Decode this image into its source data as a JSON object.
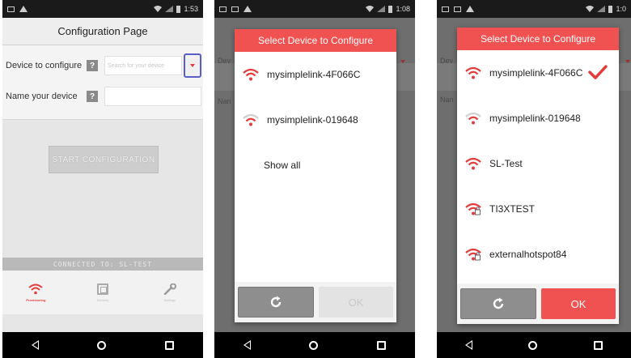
{
  "colors": {
    "accent": "#f05151",
    "focus": "#5a5fc8",
    "statusbar": "#1a1a1a"
  },
  "panel1": {
    "status": {
      "time": "1:53"
    },
    "title": "Configuration Page",
    "device_label": "Device to configure",
    "device_placeholder": "Search for your device",
    "name_label": "Name your device",
    "help_glyph": "?",
    "start_button": "START CONFIGURATION",
    "connected_text": "CONNECTED TO: SL-TEST",
    "tabs": [
      {
        "label": "Provisioning",
        "icon": "wifi-icon"
      },
      {
        "label": "Devices",
        "icon": "device-icon"
      },
      {
        "label": "Settings",
        "icon": "wrench-icon"
      }
    ]
  },
  "panel2": {
    "status": {
      "time": "1:08"
    },
    "bg_labels": [
      "Dev",
      "Nan"
    ],
    "dialog_title": "Select Device to Configure",
    "devices": [
      {
        "name": "mysimplelink-4F066C",
        "icon": "wifi-icon"
      },
      {
        "name": "mysimplelink-019648",
        "icon": "wifi-icon"
      }
    ],
    "show_all": "Show all",
    "ok_label": "OK"
  },
  "panel3": {
    "status": {
      "time": "1:0"
    },
    "bg_labels": [
      "Dev",
      "Nan"
    ],
    "dialog_title": "Select Device to Configure",
    "devices": [
      {
        "name": "mysimplelink-4F066C",
        "icon": "wifi-icon",
        "selected": true
      },
      {
        "name": "mysimplelink-019648",
        "icon": "wifi-icon",
        "selected": false
      },
      {
        "name": "SL-Test",
        "icon": "wifi-icon",
        "selected": false
      },
      {
        "name": "TI3XTEST",
        "icon": "wifi-lock-icon",
        "selected": false
      },
      {
        "name": "externalhotspot84",
        "icon": "wifi-lock-icon",
        "selected": false
      }
    ],
    "ok_label": "OK"
  }
}
